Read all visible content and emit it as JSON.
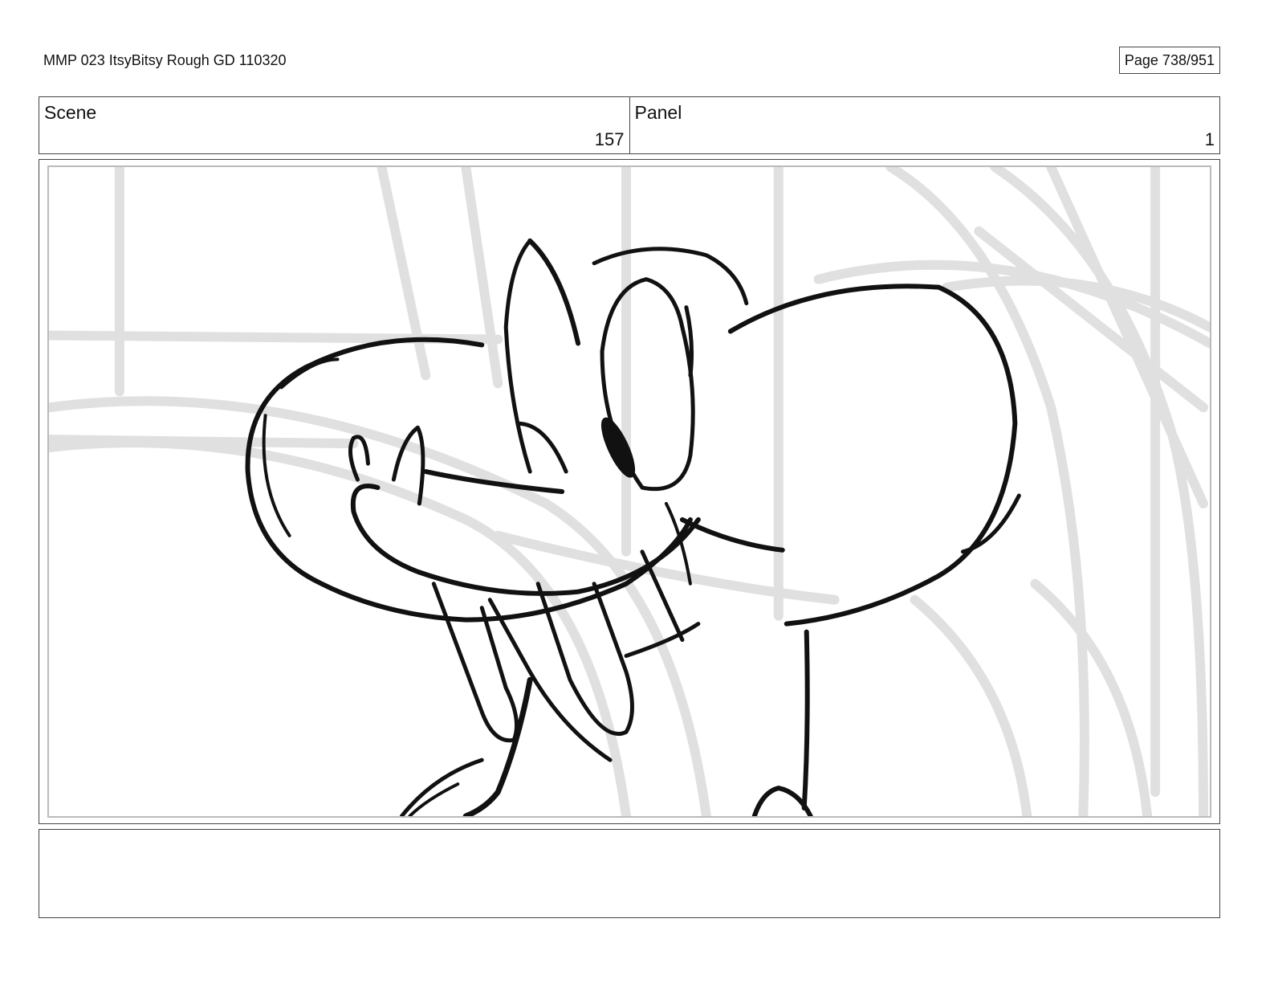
{
  "header": {
    "doc_title": "MMP 023 ItsyBitsy Rough GD 110320",
    "page_indicator": "Page 738/951"
  },
  "info": {
    "scene_label": "Scene",
    "scene_value": "157",
    "panel_label": "Panel",
    "panel_value": "1"
  },
  "notes": {
    "text": ""
  },
  "colors": {
    "ink": "#111111",
    "background_lines": "#e2e2e2",
    "border": "#444444"
  }
}
